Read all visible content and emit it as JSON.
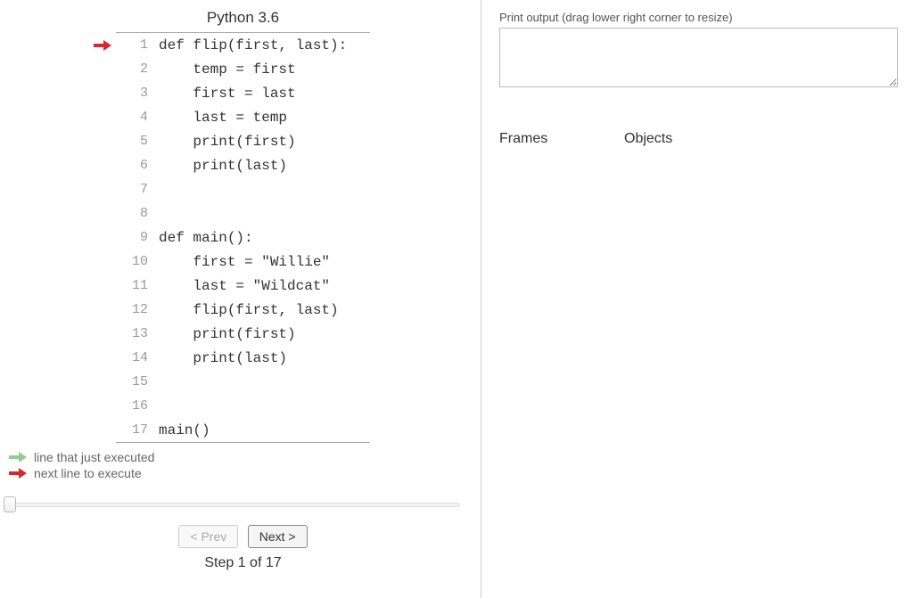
{
  "language": "Python 3.6",
  "code": {
    "lines": [
      {
        "n": 1,
        "text": "def flip(first, last):",
        "current": true
      },
      {
        "n": 2,
        "text": "    temp = first"
      },
      {
        "n": 3,
        "text": "    first = last"
      },
      {
        "n": 4,
        "text": "    last = temp"
      },
      {
        "n": 5,
        "text": "    print(first)"
      },
      {
        "n": 6,
        "text": "    print(last)"
      },
      {
        "n": 7,
        "text": ""
      },
      {
        "n": 8,
        "text": ""
      },
      {
        "n": 9,
        "text": "def main():"
      },
      {
        "n": 10,
        "text": "    first = \"Willie\""
      },
      {
        "n": 11,
        "text": "    last = \"Wildcat\""
      },
      {
        "n": 12,
        "text": "    flip(first, last)"
      },
      {
        "n": 13,
        "text": "    print(first)"
      },
      {
        "n": 14,
        "text": "    print(last)"
      },
      {
        "n": 15,
        "text": ""
      },
      {
        "n": 16,
        "text": ""
      },
      {
        "n": 17,
        "text": "main()"
      }
    ]
  },
  "legend": {
    "just_executed": "line that just executed",
    "next_line": "next line to execute"
  },
  "controls": {
    "prev_label": "< Prev",
    "next_label": "Next >",
    "step_label": "Step 1 of 17"
  },
  "output": {
    "label": "Print output (drag lower right corner to resize)",
    "value": ""
  },
  "viz": {
    "frames_label": "Frames",
    "objects_label": "Objects"
  }
}
